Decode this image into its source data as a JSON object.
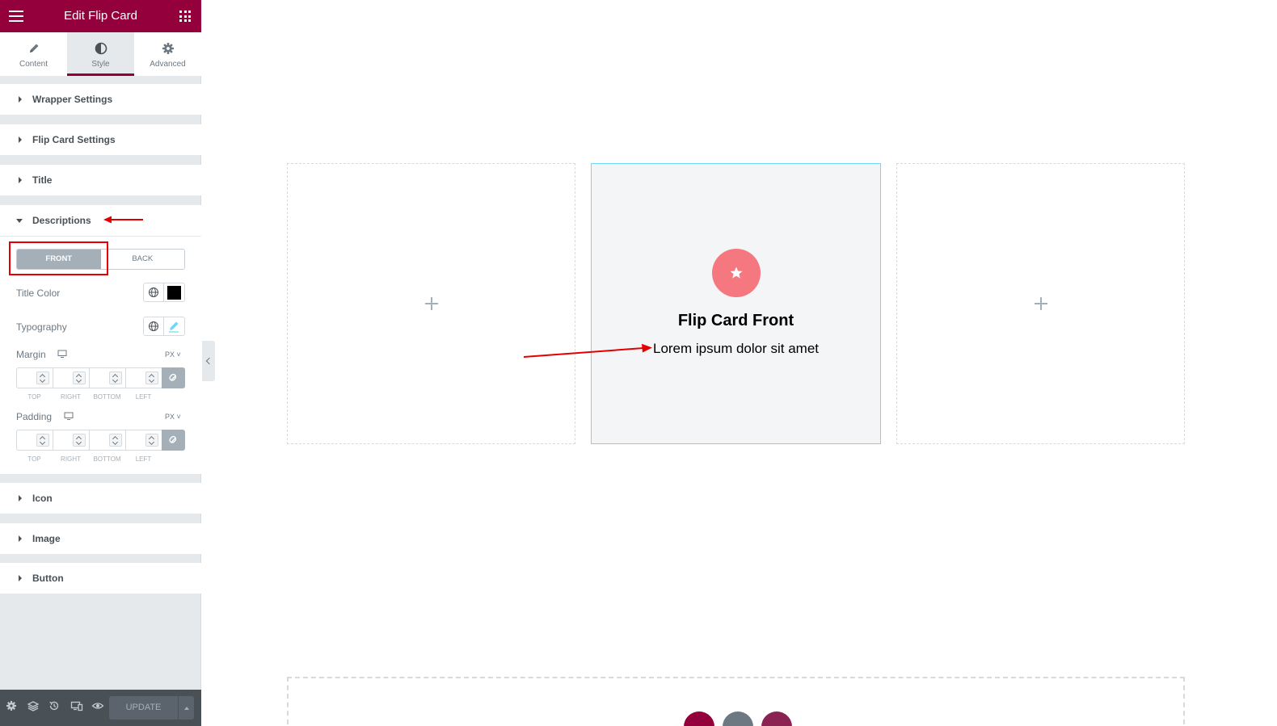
{
  "panel": {
    "header_title": "Edit Flip Card",
    "tabs": [
      {
        "label": "Content",
        "icon": "pencil-icon"
      },
      {
        "label": "Style",
        "icon": "half-circle-icon"
      },
      {
        "label": "Advanced",
        "icon": "gear-icon"
      }
    ],
    "active_tab": "Style",
    "sections": {
      "wrapper": "Wrapper Settings",
      "flip_card": "Flip Card Settings",
      "title": "Title",
      "descriptions": "Descriptions",
      "icon": "Icon",
      "image": "Image",
      "button": "Button"
    },
    "expanded_section": "Descriptions",
    "toggle": {
      "front": "FRONT",
      "back": "BACK",
      "selected": "FRONT"
    },
    "controls": {
      "title_color": "Title Color",
      "title_color_value": "#000000",
      "typography": "Typography",
      "margin": "Margin",
      "padding": "Padding",
      "unit": "PX",
      "dims": [
        "TOP",
        "RIGHT",
        "BOTTOM",
        "LEFT"
      ]
    },
    "footer": {
      "update": "UPDATE"
    }
  },
  "canvas": {
    "card": {
      "title": "Flip Card Front",
      "description": "Lorem ipsum dolor sit amet",
      "icon": "star-icon",
      "icon_bg": "#f5777f",
      "card_bg": "#f4f5f7",
      "border": "#71d7f7"
    }
  },
  "colors": {
    "brand": "#93003c",
    "annotation": "#e40000"
  }
}
